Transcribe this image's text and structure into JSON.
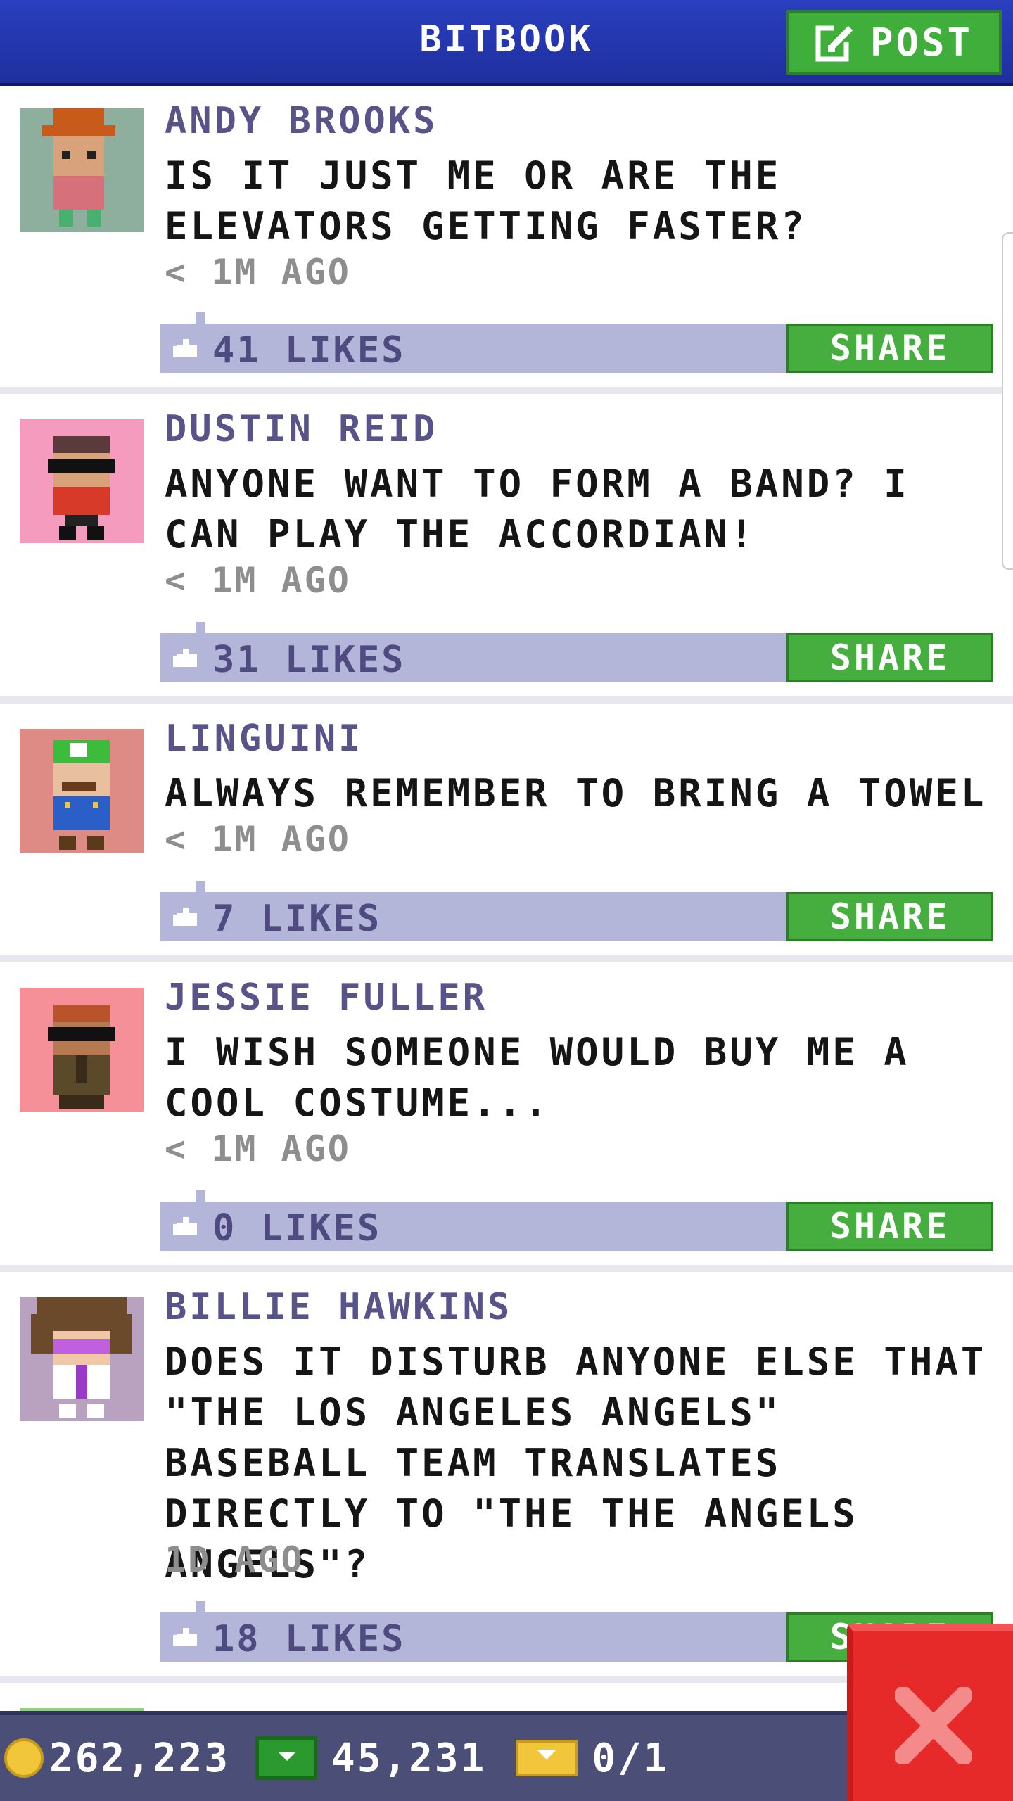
{
  "header": {
    "title": "BITBOOK",
    "post_label": "POST"
  },
  "posts": [
    {
      "author": "ANDY BROOKS",
      "text": "IS IT JUST ME OR ARE THE ELEVATORS GETTING FASTER?",
      "time": "< 1M AGO",
      "likes": "41 LIKES",
      "share_label": "SHARE",
      "avatar_bg": "#8eaf9d"
    },
    {
      "author": "DUSTIN REID",
      "text": "ANYONE WANT TO FORM A BAND? I CAN PLAY THE ACCORDIAN!",
      "time": "< 1M AGO",
      "likes": "31 LIKES",
      "share_label": "SHARE",
      "avatar_bg": "#f59bbd"
    },
    {
      "author": "LINGUINI",
      "text": "ALWAYS REMEMBER TO BRING A TOWEL",
      "time": "< 1M AGO",
      "likes": "7 LIKES",
      "share_label": "SHARE",
      "avatar_bg": "#de8a85"
    },
    {
      "author": "JESSIE FULLER",
      "text": "I WISH SOMEONE WOULD BUY ME A COOL COSTUME...",
      "time": "< 1M AGO",
      "likes": "0 LIKES",
      "share_label": "SHARE",
      "avatar_bg": "#f58f98"
    },
    {
      "author": "BILLIE HAWKINS",
      "text": "DOES IT DISTURB ANYONE ELSE THAT \"THE LOS ANGELES ANGELS\" BASEBALL TEAM TRANSLATES DIRECTLY TO \"THE THE ANGELS ANGELS\"?",
      "time": "1D AGO",
      "likes": "18 LIKES",
      "share_label": "SHARE",
      "avatar_bg": "#b9a2bf"
    }
  ],
  "bottom_bar": {
    "coins": "262,223",
    "bux": "45,231",
    "tickets": "0/1"
  },
  "colors": {
    "header": "#2a3fbf",
    "accent_green": "#46ad3f",
    "like_bar": "#b3b6d8",
    "close_red": "#e62a2a"
  },
  "icons": {
    "post": "edit-icon",
    "like": "thumbs-up-icon",
    "coin": "coin-icon",
    "bux": "bux-icon",
    "ticket": "ticket-icon",
    "close": "close-icon"
  }
}
